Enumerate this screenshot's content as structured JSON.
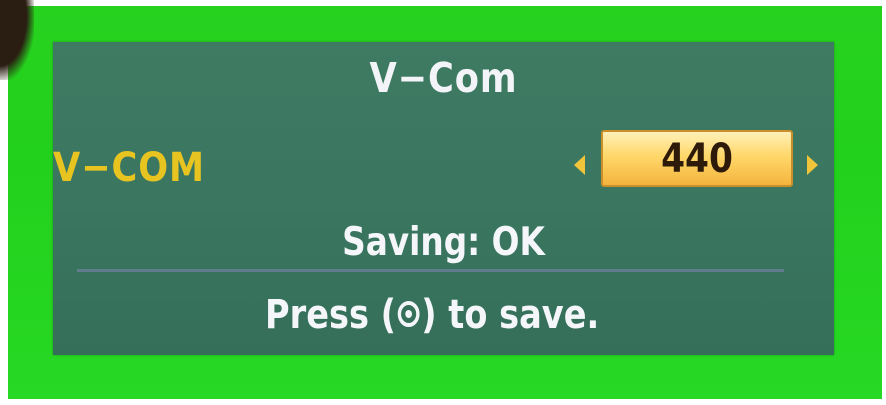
{
  "osd": {
    "title": "V−Com",
    "setting_label": "V−COM",
    "setting_value": "440",
    "status_text": "Saving: OK",
    "hint_prefix": "Press (",
    "hint_icon": "ok-button-icon",
    "hint_suffix": ") to save."
  },
  "colors": {
    "background": "#22d11c",
    "panel": "#3a7660",
    "label": "#e8c421",
    "value_box": "#ffd86a",
    "text": "#f4f6fa"
  }
}
